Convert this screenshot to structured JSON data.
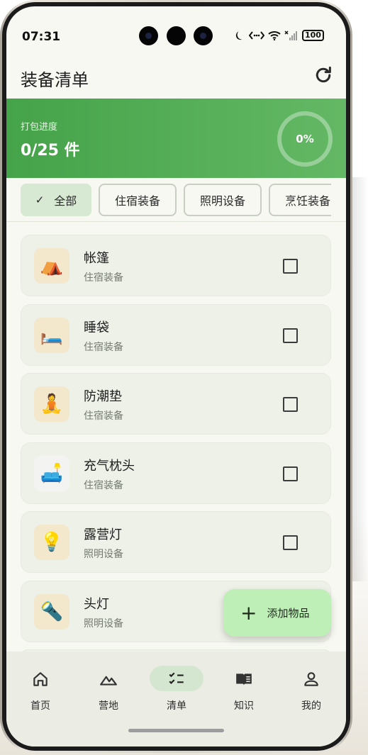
{
  "status_bar": {
    "time": "07:31",
    "battery": "100"
  },
  "app_bar": {
    "title": "装备清单",
    "refresh_icon": "refresh-icon"
  },
  "progress": {
    "label": "打包进度",
    "value_text": "0/25 件",
    "percent_text": "0%",
    "percent": 0
  },
  "filters": [
    {
      "label": "全部",
      "selected": true
    },
    {
      "label": "住宿装备",
      "selected": false
    },
    {
      "label": "照明设备",
      "selected": false
    },
    {
      "label": "烹饪装备",
      "selected": false
    }
  ],
  "items": [
    {
      "name": "帐篷",
      "category": "住宿装备",
      "emoji": "⛺",
      "checked": false
    },
    {
      "name": "睡袋",
      "category": "住宿装备",
      "emoji": "🛏️",
      "checked": false
    },
    {
      "name": "防潮垫",
      "category": "住宿装备",
      "emoji": "🧘",
      "checked": false
    },
    {
      "name": "充气枕头",
      "category": "住宿装备",
      "emoji": "🛋️",
      "checked": false
    },
    {
      "name": "露营灯",
      "category": "照明设备",
      "emoji": "💡",
      "checked": false
    },
    {
      "name": "头灯",
      "category": "照明设备",
      "emoji": "🔦",
      "checked": false
    }
  ],
  "fab": {
    "label": "添加物品"
  },
  "bottom_nav": [
    {
      "label": "首页",
      "icon": "home-icon",
      "active": false
    },
    {
      "label": "营地",
      "icon": "mountain-icon",
      "active": false
    },
    {
      "label": "清单",
      "icon": "checklist-icon",
      "active": true
    },
    {
      "label": "知识",
      "icon": "book-icon",
      "active": false
    },
    {
      "label": "我的",
      "icon": "person-icon",
      "active": false
    }
  ],
  "colors": {
    "accent": "#45a349",
    "banner_end": "#64b865",
    "fab": "#bdefb6",
    "chip_selected": "#d7e8d3"
  }
}
